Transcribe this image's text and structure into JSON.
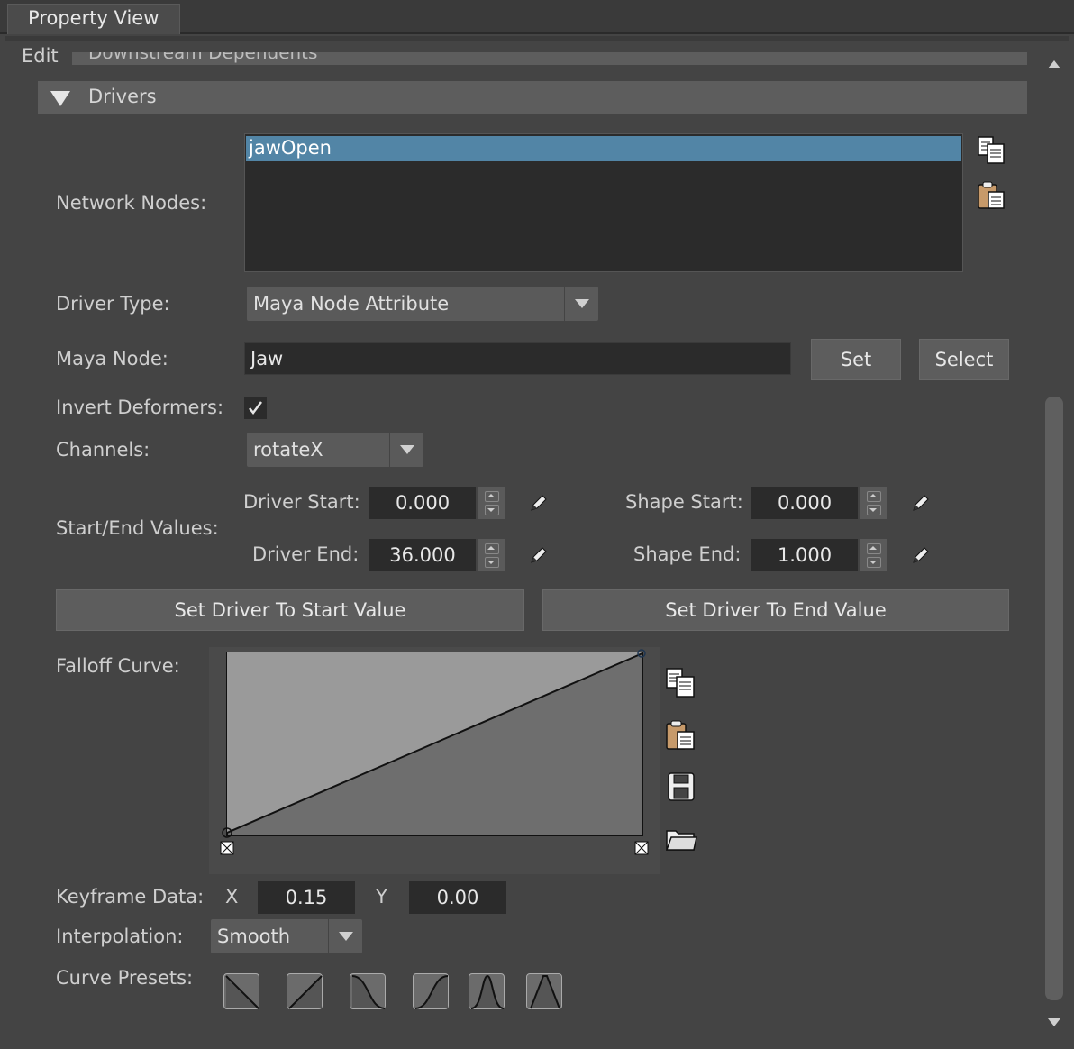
{
  "panel": {
    "title": "Property View"
  },
  "edit": {
    "label": "Edit",
    "scroll_hint": "Downstream Dependents"
  },
  "drivers": {
    "section_label": "Drivers",
    "network_nodes": {
      "label": "Network Nodes:",
      "items": [
        "jawOpen"
      ]
    },
    "driver_type": {
      "label": "Driver Type:",
      "value": "Maya Node Attribute"
    },
    "maya_node": {
      "label": "Maya Node:",
      "value": "Jaw",
      "set_label": "Set",
      "select_label": "Select"
    },
    "invert_deformers": {
      "label": "Invert Deformers:",
      "checked": true
    },
    "channels": {
      "label": "Channels:",
      "value": "rotateX"
    },
    "start_end": {
      "label": "Start/End Values:",
      "driver_start": {
        "label": "Driver Start:",
        "value": "0.000"
      },
      "driver_end": {
        "label": "Driver End:",
        "value": "36.000"
      },
      "shape_start": {
        "label": "Shape Start:",
        "value": "0.000"
      },
      "shape_end": {
        "label": "Shape End:",
        "value": "1.000"
      }
    },
    "set_start_label": "Set Driver To Start Value",
    "set_end_label": "Set Driver To End Value",
    "falloff": {
      "label": "Falloff Curve:"
    },
    "keyframe": {
      "label": "Keyframe Data:",
      "x_label": "X",
      "x_value": "0.15",
      "y_label": "Y",
      "y_value": "0.00"
    },
    "interpolation": {
      "label": "Interpolation:",
      "value": "Smooth"
    },
    "curve_presets": {
      "label": "Curve Presets:"
    }
  },
  "colors": {
    "selection": "#5285a6",
    "panel": "#444444",
    "field": "#2b2b2b",
    "button": "#5d5d5d"
  },
  "icons": [
    "copy-icon",
    "paste-icon",
    "pencil-icon",
    "save-icon",
    "folder-icon",
    "checkmark-icon",
    "triangle-down-icon"
  ]
}
